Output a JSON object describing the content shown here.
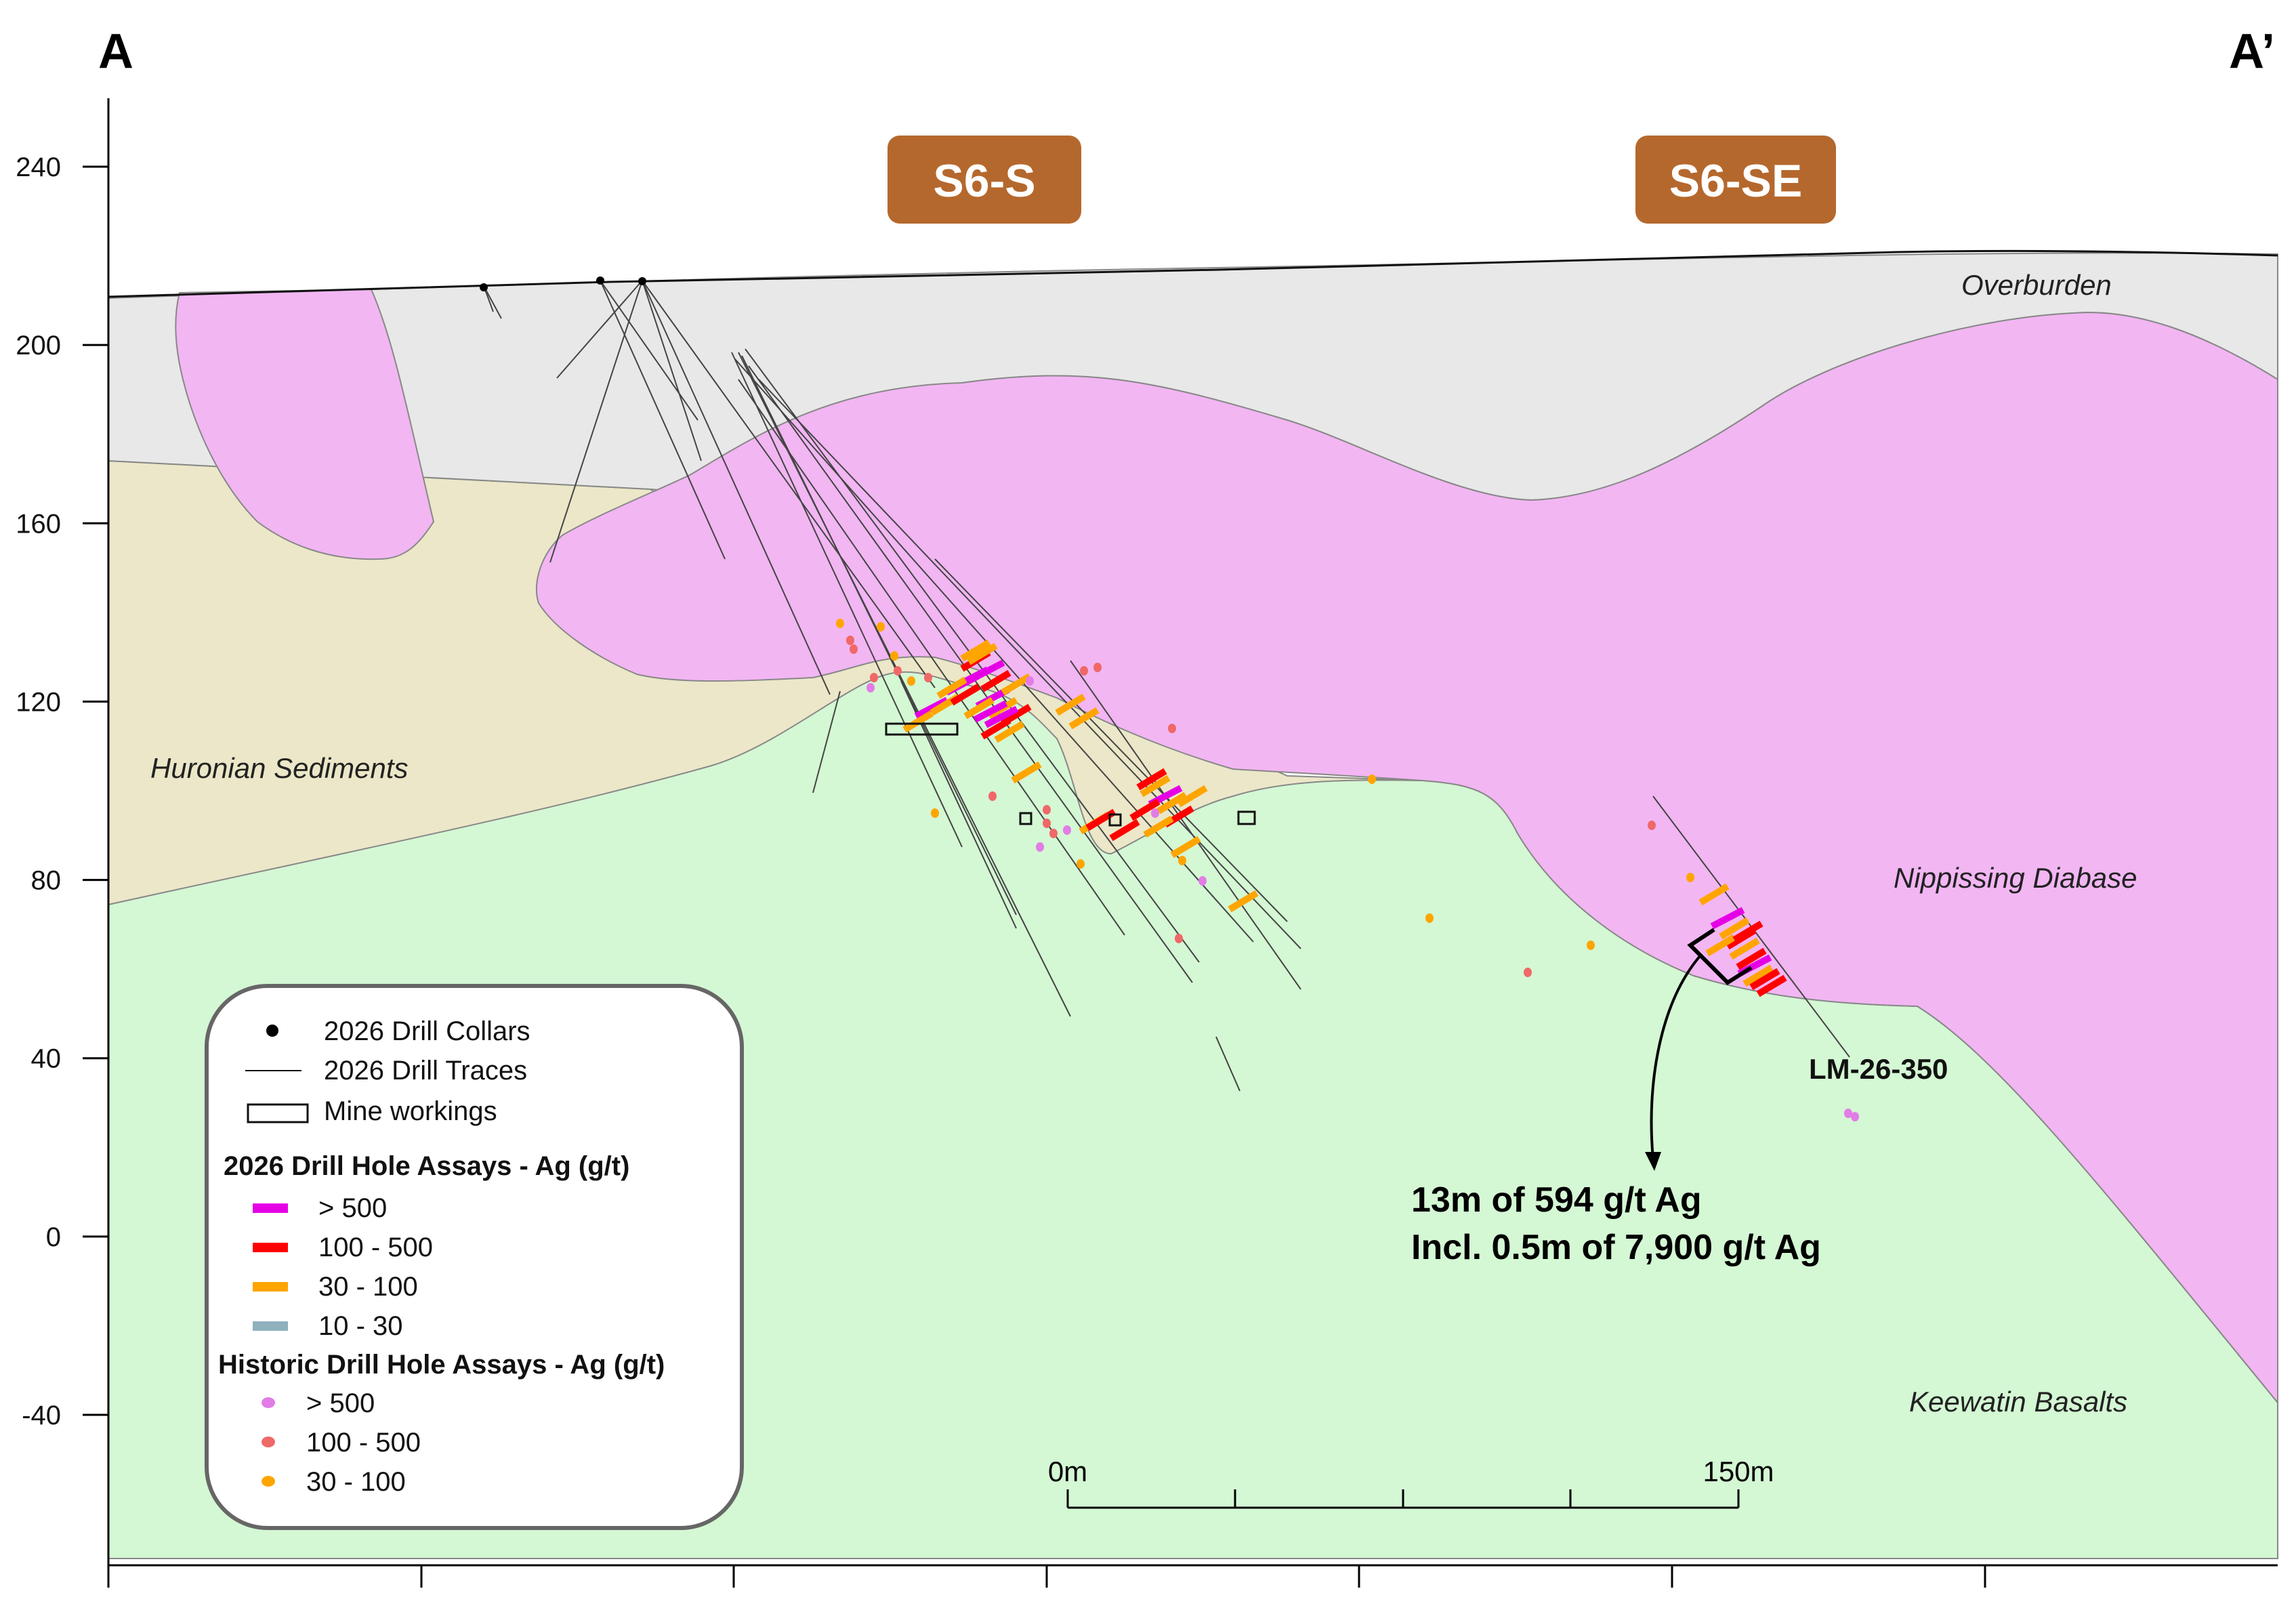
{
  "section": {
    "left_label": "A",
    "right_label": "A’"
  },
  "y_axis": {
    "ticks": [
      240,
      200,
      160,
      120,
      80,
      40,
      0,
      -40
    ],
    "tick_labels": [
      "240",
      "200",
      "160",
      "120",
      "80",
      "40",
      "0",
      "-40"
    ]
  },
  "zones": [
    {
      "label": "S6-S",
      "fill": "#b5682d"
    },
    {
      "label": "S6-SE",
      "fill": "#b5682d"
    }
  ],
  "units": {
    "overburden": {
      "label": "Overburden",
      "fill": "#e8e8e8"
    },
    "huronian": {
      "label": "Huronian Sediments",
      "fill": "#ebe7c8"
    },
    "diabase": {
      "label": "Nippissing Diabase",
      "fill": "#f2b6f3"
    },
    "basalts": {
      "label": "Keewatin Basalts",
      "fill": "#d4f7d4"
    }
  },
  "drill_hole_label": "LM-26-350",
  "callout": {
    "line1": "13m of 594 g/t Ag",
    "line2": "Incl. 0.5m of 7,900 g/t Ag"
  },
  "scale_bar": {
    "start_label": "0m",
    "end_label": "150m"
  },
  "legend": {
    "collars": "2026 Drill Collars",
    "traces": "2026 Drill Traces",
    "workings": "Mine workings",
    "assays_2026_title": "2026 Drill Hole Assays - Ag (g/t)",
    "assays_2026": [
      {
        "label": "> 500",
        "color": "#e600e6"
      },
      {
        "label": "100 - 500",
        "color": "#ff0000"
      },
      {
        "label": "30 - 100",
        "color": "#ffa500"
      },
      {
        "label": "10 - 30",
        "color": "#8fb0bd"
      }
    ],
    "assays_hist_title": "Historic Drill Hole Assays - Ag (g/t)",
    "assays_hist": [
      {
        "label": "> 500",
        "color": "#e27ce6"
      },
      {
        "label": "100 - 500",
        "color": "#f06868"
      },
      {
        "label": "30 - 100",
        "color": "#ffa500"
      }
    ]
  }
}
